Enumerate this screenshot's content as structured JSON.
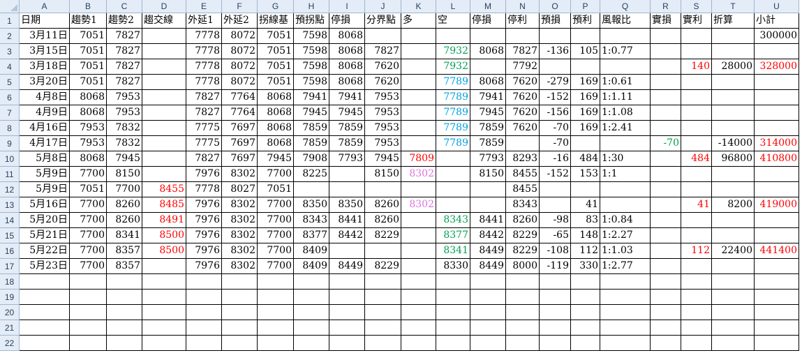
{
  "sheet": {
    "columns": [
      "A",
      "B",
      "C",
      "D",
      "E",
      "F",
      "G",
      "H",
      "I",
      "J",
      "K",
      "L",
      "M",
      "N",
      "O",
      "P",
      "Q",
      "R",
      "S",
      "T",
      "U"
    ],
    "row_numbers": [
      1,
      2,
      3,
      4,
      5,
      6,
      7,
      8,
      9,
      10,
      11,
      12,
      13,
      14,
      15,
      16,
      17,
      18,
      19,
      20,
      21,
      22
    ],
    "colors": {
      "red": "#ff0000",
      "green": "#00a050",
      "cyan": "#00a0e0",
      "pink": "#e070e0"
    },
    "rows": [
      [
        {
          "v": "日期"
        },
        {
          "v": "趨勢1"
        },
        {
          "v": "趨勢2"
        },
        {
          "v": "趨交線"
        },
        {
          "v": "外延1"
        },
        {
          "v": "外延2"
        },
        {
          "v": "拐線基"
        },
        {
          "v": "預拐點"
        },
        {
          "v": "停損"
        },
        {
          "v": "分界點"
        },
        {
          "v": "多"
        },
        {
          "v": "空"
        },
        {
          "v": "停損"
        },
        {
          "v": "停利"
        },
        {
          "v": "預損"
        },
        {
          "v": "預利"
        },
        {
          "v": "風報比"
        },
        {
          "v": "實損"
        },
        {
          "v": "實利"
        },
        {
          "v": "折算"
        },
        {
          "v": "小計"
        }
      ],
      [
        {
          "v": "3月11日",
          "d": 1
        },
        {
          "v": "7051"
        },
        {
          "v": "7827"
        },
        {
          "v": ""
        },
        {
          "v": "7778"
        },
        {
          "v": "8072"
        },
        {
          "v": "7051"
        },
        {
          "v": "7598"
        },
        {
          "v": "8068"
        },
        {
          "v": ""
        },
        {
          "v": ""
        },
        {
          "v": ""
        },
        {
          "v": ""
        },
        {
          "v": ""
        },
        {
          "v": ""
        },
        {
          "v": ""
        },
        {
          "v": ""
        },
        {
          "v": ""
        },
        {
          "v": ""
        },
        {
          "v": ""
        },
        {
          "v": "300000"
        }
      ],
      [
        {
          "v": "3月15日",
          "d": 1
        },
        {
          "v": "7051"
        },
        {
          "v": "7827"
        },
        {
          "v": ""
        },
        {
          "v": "7778"
        },
        {
          "v": "8072"
        },
        {
          "v": "7051"
        },
        {
          "v": "7598"
        },
        {
          "v": "8068"
        },
        {
          "v": "7827"
        },
        {
          "v": ""
        },
        {
          "v": "7932",
          "c": "green"
        },
        {
          "v": "8068"
        },
        {
          "v": "7827"
        },
        {
          "v": "-136"
        },
        {
          "v": "105"
        },
        {
          "v": "1:0.77",
          "t": 1
        },
        {
          "v": ""
        },
        {
          "v": ""
        },
        {
          "v": ""
        },
        {
          "v": ""
        }
      ],
      [
        {
          "v": "3月18日",
          "d": 1
        },
        {
          "v": "7051"
        },
        {
          "v": "7827"
        },
        {
          "v": ""
        },
        {
          "v": "7778"
        },
        {
          "v": "8072"
        },
        {
          "v": "7051"
        },
        {
          "v": "7598"
        },
        {
          "v": "8068"
        },
        {
          "v": "7620"
        },
        {
          "v": ""
        },
        {
          "v": "7932",
          "c": "green"
        },
        {
          "v": ""
        },
        {
          "v": "7792"
        },
        {
          "v": ""
        },
        {
          "v": ""
        },
        {
          "v": ""
        },
        {
          "v": ""
        },
        {
          "v": "140",
          "c": "red"
        },
        {
          "v": "28000"
        },
        {
          "v": "328000",
          "c": "red"
        }
      ],
      [
        {
          "v": "3月20日",
          "d": 1
        },
        {
          "v": "7051"
        },
        {
          "v": "7827"
        },
        {
          "v": ""
        },
        {
          "v": "7778"
        },
        {
          "v": "8072"
        },
        {
          "v": "7051"
        },
        {
          "v": "7598"
        },
        {
          "v": "8068"
        },
        {
          "v": "7620"
        },
        {
          "v": ""
        },
        {
          "v": "7789",
          "c": "cyan"
        },
        {
          "v": "8068"
        },
        {
          "v": "7620"
        },
        {
          "v": "-279"
        },
        {
          "v": "169"
        },
        {
          "v": "1:0.61",
          "t": 1
        },
        {
          "v": ""
        },
        {
          "v": ""
        },
        {
          "v": ""
        },
        {
          "v": ""
        }
      ],
      [
        {
          "v": "4月8日",
          "d": 1
        },
        {
          "v": "8068"
        },
        {
          "v": "7953"
        },
        {
          "v": ""
        },
        {
          "v": "7827"
        },
        {
          "v": "7764"
        },
        {
          "v": "8068"
        },
        {
          "v": "7941"
        },
        {
          "v": "7941"
        },
        {
          "v": "7953"
        },
        {
          "v": ""
        },
        {
          "v": "7789",
          "c": "cyan"
        },
        {
          "v": "7941"
        },
        {
          "v": "7620"
        },
        {
          "v": "-152"
        },
        {
          "v": "169"
        },
        {
          "v": "1:1.11",
          "t": 1
        },
        {
          "v": ""
        },
        {
          "v": ""
        },
        {
          "v": ""
        },
        {
          "v": ""
        }
      ],
      [
        {
          "v": "4月9日",
          "d": 1
        },
        {
          "v": "8068"
        },
        {
          "v": "7953"
        },
        {
          "v": ""
        },
        {
          "v": "7827"
        },
        {
          "v": "7764"
        },
        {
          "v": "8068"
        },
        {
          "v": "7945"
        },
        {
          "v": "7945"
        },
        {
          "v": "7953"
        },
        {
          "v": ""
        },
        {
          "v": "7789",
          "c": "cyan"
        },
        {
          "v": "7945"
        },
        {
          "v": "7620"
        },
        {
          "v": "-156"
        },
        {
          "v": "169"
        },
        {
          "v": "1:1.08",
          "t": 1
        },
        {
          "v": ""
        },
        {
          "v": ""
        },
        {
          "v": ""
        },
        {
          "v": ""
        }
      ],
      [
        {
          "v": "4月16日",
          "d": 1
        },
        {
          "v": "7953"
        },
        {
          "v": "7832"
        },
        {
          "v": ""
        },
        {
          "v": "7775"
        },
        {
          "v": "7697"
        },
        {
          "v": "8068"
        },
        {
          "v": "7859"
        },
        {
          "v": "7859"
        },
        {
          "v": "7953"
        },
        {
          "v": ""
        },
        {
          "v": "7789",
          "c": "cyan"
        },
        {
          "v": "7859"
        },
        {
          "v": "7620"
        },
        {
          "v": "-70"
        },
        {
          "v": "169"
        },
        {
          "v": "1:2.41",
          "t": 1
        },
        {
          "v": ""
        },
        {
          "v": ""
        },
        {
          "v": ""
        },
        {
          "v": ""
        }
      ],
      [
        {
          "v": "4月17日",
          "d": 1
        },
        {
          "v": "7953"
        },
        {
          "v": "7832"
        },
        {
          "v": ""
        },
        {
          "v": "7775"
        },
        {
          "v": "7697"
        },
        {
          "v": "8068"
        },
        {
          "v": "7859"
        },
        {
          "v": "7859"
        },
        {
          "v": "7953"
        },
        {
          "v": ""
        },
        {
          "v": "7789",
          "c": "cyan"
        },
        {
          "v": "7859"
        },
        {
          "v": ""
        },
        {
          "v": "-70"
        },
        {
          "v": ""
        },
        {
          "v": ""
        },
        {
          "v": "-70",
          "c": "green"
        },
        {
          "v": ""
        },
        {
          "v": "-14000"
        },
        {
          "v": "314000",
          "c": "red"
        }
      ],
      [
        {
          "v": "5月8日",
          "d": 1
        },
        {
          "v": "8068"
        },
        {
          "v": "7945"
        },
        {
          "v": ""
        },
        {
          "v": "7827"
        },
        {
          "v": "7697"
        },
        {
          "v": "7945"
        },
        {
          "v": "7908"
        },
        {
          "v": "7793"
        },
        {
          "v": "7945"
        },
        {
          "v": "7809",
          "c": "red"
        },
        {
          "v": ""
        },
        {
          "v": "7793"
        },
        {
          "v": "8293"
        },
        {
          "v": "-16"
        },
        {
          "v": "484"
        },
        {
          "v": "1:30",
          "t": 1
        },
        {
          "v": ""
        },
        {
          "v": "484",
          "c": "red"
        },
        {
          "v": "96800"
        },
        {
          "v": "410800",
          "c": "red"
        }
      ],
      [
        {
          "v": "5月9日",
          "d": 1
        },
        {
          "v": "7700"
        },
        {
          "v": "8150"
        },
        {
          "v": ""
        },
        {
          "v": "7976"
        },
        {
          "v": "8302"
        },
        {
          "v": "7700"
        },
        {
          "v": "8225"
        },
        {
          "v": ""
        },
        {
          "v": "8150"
        },
        {
          "v": "8302",
          "c": "pink"
        },
        {
          "v": ""
        },
        {
          "v": "8150"
        },
        {
          "v": "8455"
        },
        {
          "v": "-152"
        },
        {
          "v": "153"
        },
        {
          "v": "1:1",
          "t": 1
        },
        {
          "v": ""
        },
        {
          "v": ""
        },
        {
          "v": ""
        },
        {
          "v": ""
        }
      ],
      [
        {
          "v": "5月9日",
          "d": 1
        },
        {
          "v": "7051"
        },
        {
          "v": "7700"
        },
        {
          "v": "8455",
          "c": "red"
        },
        {
          "v": "7778"
        },
        {
          "v": "8027"
        },
        {
          "v": "7051"
        },
        {
          "v": ""
        },
        {
          "v": ""
        },
        {
          "v": ""
        },
        {
          "v": ""
        },
        {
          "v": ""
        },
        {
          "v": ""
        },
        {
          "v": "8455"
        },
        {
          "v": ""
        },
        {
          "v": ""
        },
        {
          "v": ""
        },
        {
          "v": ""
        },
        {
          "v": ""
        },
        {
          "v": ""
        },
        {
          "v": ""
        }
      ],
      [
        {
          "v": "5月16日",
          "d": 1
        },
        {
          "v": "7700"
        },
        {
          "v": "8260"
        },
        {
          "v": "8485",
          "c": "red"
        },
        {
          "v": "7976"
        },
        {
          "v": "8302"
        },
        {
          "v": "7700"
        },
        {
          "v": "8350"
        },
        {
          "v": "8350"
        },
        {
          "v": "8260"
        },
        {
          "v": "8302",
          "c": "pink"
        },
        {
          "v": ""
        },
        {
          "v": ""
        },
        {
          "v": "8343"
        },
        {
          "v": ""
        },
        {
          "v": "41"
        },
        {
          "v": ""
        },
        {
          "v": ""
        },
        {
          "v": "41",
          "c": "red"
        },
        {
          "v": "8200"
        },
        {
          "v": "419000",
          "c": "red"
        }
      ],
      [
        {
          "v": "5月20日",
          "d": 1
        },
        {
          "v": "7700"
        },
        {
          "v": "8260"
        },
        {
          "v": "8491",
          "c": "red"
        },
        {
          "v": "7976"
        },
        {
          "v": "8302"
        },
        {
          "v": "7700"
        },
        {
          "v": "8343"
        },
        {
          "v": "8441"
        },
        {
          "v": "8260"
        },
        {
          "v": ""
        },
        {
          "v": "8343",
          "c": "green"
        },
        {
          "v": "8441"
        },
        {
          "v": "8260"
        },
        {
          "v": "-98"
        },
        {
          "v": "83"
        },
        {
          "v": "1:0.84",
          "t": 1
        },
        {
          "v": ""
        },
        {
          "v": ""
        },
        {
          "v": ""
        },
        {
          "v": ""
        }
      ],
      [
        {
          "v": "5月21日",
          "d": 1
        },
        {
          "v": "7700"
        },
        {
          "v": "8341"
        },
        {
          "v": "8500",
          "c": "red"
        },
        {
          "v": "7976"
        },
        {
          "v": "8302"
        },
        {
          "v": "7700"
        },
        {
          "v": "8377"
        },
        {
          "v": "8442"
        },
        {
          "v": "8229"
        },
        {
          "v": ""
        },
        {
          "v": "8377",
          "c": "green"
        },
        {
          "v": "8442"
        },
        {
          "v": "8229"
        },
        {
          "v": "-65"
        },
        {
          "v": "148"
        },
        {
          "v": "1:2.27",
          "t": 1
        },
        {
          "v": ""
        },
        {
          "v": ""
        },
        {
          "v": ""
        },
        {
          "v": ""
        }
      ],
      [
        {
          "v": "5月22日",
          "d": 1
        },
        {
          "v": "7700"
        },
        {
          "v": "8357"
        },
        {
          "v": "8500",
          "c": "red"
        },
        {
          "v": "7976"
        },
        {
          "v": "8302"
        },
        {
          "v": "7700"
        },
        {
          "v": "8409"
        },
        {
          "v": ""
        },
        {
          "v": ""
        },
        {
          "v": ""
        },
        {
          "v": "8341",
          "c": "green"
        },
        {
          "v": "8449"
        },
        {
          "v": "8229"
        },
        {
          "v": "-108"
        },
        {
          "v": "112"
        },
        {
          "v": "1:1.03",
          "t": 1
        },
        {
          "v": ""
        },
        {
          "v": "112",
          "c": "red"
        },
        {
          "v": "22400"
        },
        {
          "v": "441400",
          "c": "red"
        }
      ],
      [
        {
          "v": "5月23日",
          "d": 1
        },
        {
          "v": "7700"
        },
        {
          "v": "8357"
        },
        {
          "v": ""
        },
        {
          "v": "7976"
        },
        {
          "v": "8302"
        },
        {
          "v": "7700"
        },
        {
          "v": "8409"
        },
        {
          "v": "8449"
        },
        {
          "v": "8229"
        },
        {
          "v": ""
        },
        {
          "v": "8330"
        },
        {
          "v": "8449"
        },
        {
          "v": "8000"
        },
        {
          "v": "-119"
        },
        {
          "v": "330"
        },
        {
          "v": "1:2.77",
          "t": 1
        },
        {
          "v": ""
        },
        {
          "v": ""
        },
        {
          "v": ""
        },
        {
          "v": ""
        }
      ]
    ]
  }
}
